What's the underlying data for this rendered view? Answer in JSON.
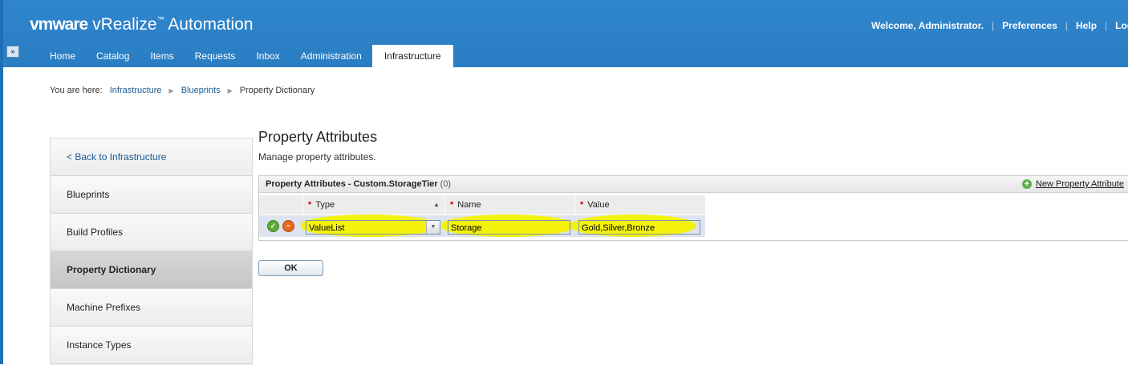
{
  "header": {
    "brand_vm": "vmware",
    "product": "vRealize",
    "product_suffix": "Automation",
    "welcome": "Welcome, Administrator.",
    "preferences": "Preferences",
    "help": "Help",
    "logout": "Logou"
  },
  "tabs": [
    "Home",
    "Catalog",
    "Items",
    "Requests",
    "Inbox",
    "Administration",
    "Infrastructure"
  ],
  "active_tab": "Infrastructure",
  "breadcrumb": {
    "prefix": "You are here:",
    "items": [
      "Infrastructure",
      "Blueprints",
      "Property Dictionary"
    ]
  },
  "sidebar": {
    "items": [
      {
        "label": "< Back to Infrastructure"
      },
      {
        "label": "Blueprints"
      },
      {
        "label": "Build Profiles"
      },
      {
        "label": "Property Dictionary"
      },
      {
        "label": "Machine Prefixes"
      },
      {
        "label": "Instance Types"
      }
    ],
    "active": "Property Dictionary"
  },
  "page": {
    "title": "Property Attributes",
    "subtitle": "Manage property attributes."
  },
  "grid": {
    "title_prefix": "Property Attributes - ",
    "title_name": "Custom.StorageTier",
    "count": "(0)",
    "new_label": "New Property Attribute",
    "columns": [
      "Type",
      "Name",
      "Value"
    ],
    "edit_row": {
      "type": "ValueList",
      "name": "Storage",
      "value": "Gold,Silver,Bronze"
    }
  },
  "ok_button": "OK",
  "colors": {
    "header_blue": "#2f86cc",
    "highlight": "#f4f200",
    "accept_green": "#5eaa36",
    "cancel_orange": "#e56a1e"
  }
}
